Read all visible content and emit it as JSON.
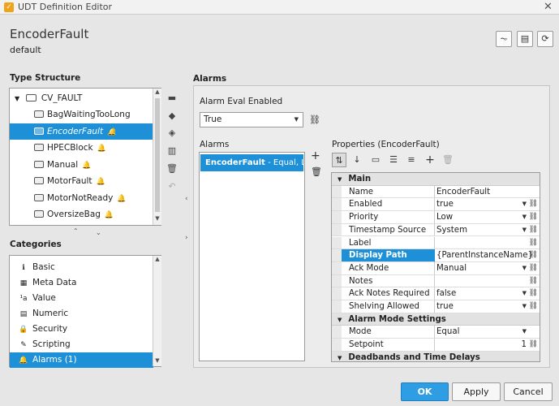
{
  "window": {
    "title": "UDT Definition Editor",
    "app_icon": "ignition-icon"
  },
  "header": {
    "name": "EncoderFault",
    "subtitle": "default"
  },
  "type_structure": {
    "title": "Type Structure",
    "root": "CV_FAULT",
    "items": [
      {
        "label": "BagWaitingTooLong",
        "bell": false
      },
      {
        "label": "EncoderFault",
        "bell": true,
        "selected": true
      },
      {
        "label": "HPECBlock",
        "bell": true
      },
      {
        "label": "Manual",
        "bell": true
      },
      {
        "label": "MotorFault",
        "bell": true
      },
      {
        "label": "MotorNotReady",
        "bell": true
      },
      {
        "label": "OversizeBag",
        "bell": true
      }
    ]
  },
  "categories": {
    "title": "Categories",
    "items": [
      {
        "label": "Basic",
        "icon": "info-icon"
      },
      {
        "label": "Meta Data",
        "icon": "meta-data-icon"
      },
      {
        "label": "Value",
        "icon": "value-icon"
      },
      {
        "label": "Numeric",
        "icon": "calculator-icon"
      },
      {
        "label": "Security",
        "icon": "lock-icon"
      },
      {
        "label": "Scripting",
        "icon": "script-icon"
      },
      {
        "label": "Alarms (1)",
        "icon": "bell-icon",
        "selected": true
      }
    ]
  },
  "alarms": {
    "title": "Alarms",
    "eval_label": "Alarm Eval Enabled",
    "eval_value": "True",
    "list_label": "Alarms",
    "list_item_name": "EncoderFault",
    "list_item_desc": " - Equal, Low",
    "props_label": "Properties (EncoderFault)"
  },
  "properties": [
    {
      "type": "cat",
      "label": "Main"
    },
    {
      "label": "Name",
      "value": "EncoderFault",
      "dropdown": false,
      "link": false
    },
    {
      "label": "Enabled",
      "value": "true",
      "dropdown": true,
      "link": true
    },
    {
      "label": "Priority",
      "value": "Low",
      "dropdown": true,
      "link": true
    },
    {
      "label": "Timestamp Source",
      "value": "System",
      "dropdown": true,
      "link": true
    },
    {
      "label": "Label",
      "value": "",
      "dropdown": false,
      "link": true
    },
    {
      "label": "Display Path",
      "value": "{ParentInstanceName}",
      "dropdown": false,
      "link": true,
      "selected": true
    },
    {
      "label": "Ack Mode",
      "value": "Manual",
      "dropdown": true,
      "link": true
    },
    {
      "label": "Notes",
      "value": "",
      "dropdown": false,
      "link": true
    },
    {
      "label": "Ack Notes Required",
      "value": "false",
      "dropdown": true,
      "link": true
    },
    {
      "label": "Shelving Allowed",
      "value": "true",
      "dropdown": true,
      "link": true
    },
    {
      "type": "cat",
      "label": "Alarm Mode Settings"
    },
    {
      "label": "Mode",
      "value": "Equal",
      "dropdown": true,
      "link": false
    },
    {
      "label": "Setpoint",
      "value": "1",
      "dropdown": false,
      "link": true,
      "align": "right"
    },
    {
      "type": "cat",
      "label": "Deadbands and Time Delays"
    }
  ],
  "buttons": {
    "ok": "OK",
    "apply": "Apply",
    "cancel": "Cancel"
  },
  "colors": {
    "selection": "#1d90d8",
    "app_icon": "#f0a21b"
  }
}
